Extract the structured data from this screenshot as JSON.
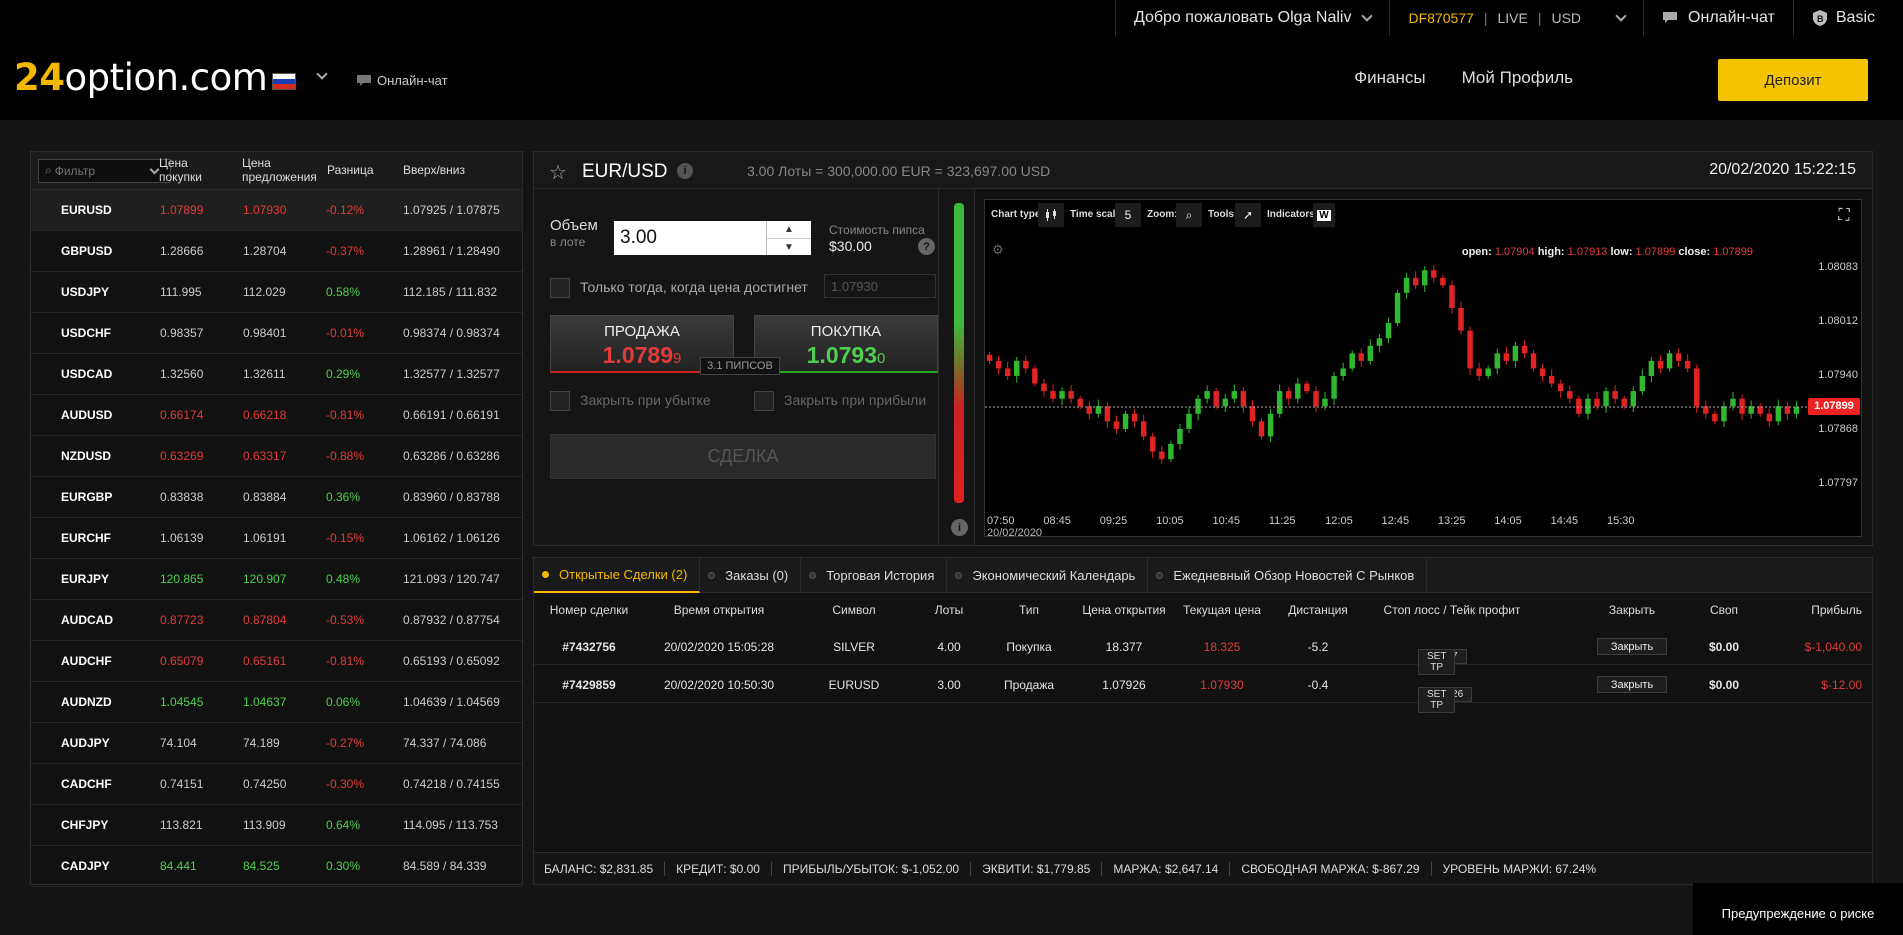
{
  "header": {
    "welcome": "Добро пожаловать Olga Naliv",
    "account_id": "DF870577",
    "separator": "|",
    "mode": "LIVE",
    "currency": "USD",
    "chat": "Онлайн-чат",
    "tier": "Basic",
    "logo_num": "24",
    "logo_rest": "option.com",
    "mini_chat": "Онлайн-чат",
    "nav": [
      "Финансы",
      "Мой Профиль"
    ],
    "deposit": "Депозит",
    "flag_colors": [
      "#ffffff",
      "#1c3fb5",
      "#d52b1e"
    ]
  },
  "watchlist": {
    "filter_placeholder": "Фильтр",
    "col_bid": "Цена покупки",
    "col_ask": "Цена предложения",
    "col_change": "Разница",
    "col_hl": "Вверх/вниз",
    "rows": [
      {
        "symbol": "EURUSD",
        "bid": "1.07899",
        "ask": "1.07930",
        "change": "-0.12%",
        "hl": "1.07925 / 1.07875",
        "color": "red"
      },
      {
        "symbol": "GBPUSD",
        "bid": "1.28666",
        "ask": "1.28704",
        "change": "-0.37%",
        "hl": "1.28961 / 1.28490",
        "color": "neut"
      },
      {
        "symbol": "USDJPY",
        "bid": "111.995",
        "ask": "112.029",
        "change": "0.58%",
        "hl": "112.185 / 111.832",
        "color": "neut"
      },
      {
        "symbol": "USDCHF",
        "bid": "0.98357",
        "ask": "0.98401",
        "change": "-0.01%",
        "hl": "0.98374 / 0.98374",
        "color": "neut"
      },
      {
        "symbol": "USDCAD",
        "bid": "1.32560",
        "ask": "1.32611",
        "change": "0.29%",
        "hl": "1.32577 / 1.32577",
        "color": "neut"
      },
      {
        "symbol": "AUDUSD",
        "bid": "0.66174",
        "ask": "0.66218",
        "change": "-0.81%",
        "hl": "0.66191 / 0.66191",
        "color": "red"
      },
      {
        "symbol": "NZDUSD",
        "bid": "0.63269",
        "ask": "0.63317",
        "change": "-0.88%",
        "hl": "0.63286 / 0.63286",
        "color": "red"
      },
      {
        "symbol": "EURGBP",
        "bid": "0.83838",
        "ask": "0.83884",
        "change": "0.36%",
        "hl": "0.83960 / 0.83788",
        "color": "neut"
      },
      {
        "symbol": "EURCHF",
        "bid": "1.06139",
        "ask": "1.06191",
        "change": "-0.15%",
        "hl": "1.06162 / 1.06126",
        "color": "neut"
      },
      {
        "symbol": "EURJPY",
        "bid": "120.865",
        "ask": "120.907",
        "change": "0.48%",
        "hl": "121.093 / 120.747",
        "color": "green"
      },
      {
        "symbol": "AUDCAD",
        "bid": "0.87723",
        "ask": "0.87804",
        "change": "-0.53%",
        "hl": "0.87932 / 0.87754",
        "color": "red"
      },
      {
        "symbol": "AUDCHF",
        "bid": "0.65079",
        "ask": "0.65161",
        "change": "-0.81%",
        "hl": "0.65193 / 0.65092",
        "color": "red"
      },
      {
        "symbol": "AUDNZD",
        "bid": "1.04545",
        "ask": "1.04637",
        "change": "0.06%",
        "hl": "1.04639 / 1.04569",
        "color": "green"
      },
      {
        "symbol": "AUDJPY",
        "bid": "74.104",
        "ask": "74.189",
        "change": "-0.27%",
        "hl": "74.337 / 74.086",
        "color": "neut"
      },
      {
        "symbol": "CADCHF",
        "bid": "0.74151",
        "ask": "0.74250",
        "change": "-0.30%",
        "hl": "0.74218 / 0.74155",
        "color": "neut"
      },
      {
        "symbol": "CHFJPY",
        "bid": "113.821",
        "ask": "113.909",
        "change": "0.64%",
        "hl": "114.095 / 113.753",
        "color": "neut"
      },
      {
        "symbol": "CADJPY",
        "bid": "84.441",
        "ask": "84.525",
        "change": "0.30%",
        "hl": "84.589 / 84.339",
        "color": "green"
      }
    ]
  },
  "trade": {
    "pair": "EUR/USD",
    "lot_info": "3.00 Лоты = 300,000.00 EUR = 323,697.00 USD",
    "datetime": "20/02/2020 15:22:15",
    "volume_label": "Объем",
    "volume_sub": "в лоте",
    "volume_value": "3.00",
    "pip_cost_label": "Стоимость пипса",
    "pip_cost_value": "$30.00",
    "limit_label": "Только тогда, когда цена достигнет",
    "limit_placeholder": "1.07930",
    "sell_label": "ПРОДАЖА",
    "sell_price_main": "1.0789",
    "sell_price_tail": "9",
    "buy_label": "ПОКУПКА",
    "buy_price_main": "1.0793",
    "buy_price_tail": "0",
    "spread": "3.1 ПИПСОВ",
    "stop_loss": "Закрыть при убытке",
    "take_profit": "Закрыть при прибыли",
    "deal": "СДЕЛКА"
  },
  "chart_toolbar": {
    "chart_type": "Chart type:",
    "time_scale": "Time scale",
    "time_scale_value": "5",
    "zoom": "Zoom:",
    "tools": "Tools:",
    "indicators": "Indicators:",
    "indicators_icon": "W"
  },
  "chart_data": {
    "type": "candlestick",
    "symbol": "EUR/USD",
    "interval_minutes": 5,
    "ohlc_labels": {
      "open": "open:",
      "high": "high:",
      "low": "low:",
      "close": "close:"
    },
    "last_ohlc": {
      "open": "1.07904",
      "high": "1.07913",
      "low": "1.07899",
      "close": "1.07899"
    },
    "last_price": "1.07899",
    "y_ticks": [
      "1.08083",
      "1.08012",
      "1.07940",
      "1.07868",
      "1.07797"
    ],
    "ylim": [
      1.0776,
      1.0812
    ],
    "x_ticks": [
      "07:50",
      "08:45",
      "09:25",
      "10:05",
      "10:45",
      "11:25",
      "12:05",
      "12:45",
      "13:25",
      "14:05",
      "14:45",
      "15:30"
    ],
    "date_label": "20/02/2020",
    "closes": [
      1.0796,
      1.0795,
      1.0794,
      1.0796,
      1.0795,
      1.0793,
      1.0792,
      1.0791,
      1.0792,
      1.0791,
      1.079,
      1.0789,
      1.079,
      1.0788,
      1.0787,
      1.0789,
      1.0788,
      1.0786,
      1.0784,
      1.0783,
      1.0785,
      1.0787,
      1.0789,
      1.0791,
      1.0792,
      1.079,
      1.0791,
      1.0792,
      1.079,
      1.0788,
      1.0786,
      1.0789,
      1.0792,
      1.0791,
      1.0793,
      1.0792,
      1.079,
      1.0791,
      1.0794,
      1.0795,
      1.0797,
      1.0796,
      1.0798,
      1.0799,
      1.0801,
      1.0805,
      1.0807,
      1.0806,
      1.0808,
      1.0807,
      1.0806,
      1.0803,
      1.08,
      1.0795,
      1.0794,
      1.0795,
      1.0797,
      1.0796,
      1.0798,
      1.0797,
      1.0795,
      1.0794,
      1.0793,
      1.0792,
      1.0791,
      1.0789,
      1.0791,
      1.079,
      1.0792,
      1.0791,
      1.079,
      1.0792,
      1.0794,
      1.0796,
      1.0795,
      1.0797,
      1.0796,
      1.0795,
      1.079,
      1.0789,
      1.0788,
      1.079,
      1.0791,
      1.0789,
      1.079,
      1.0789,
      1.0788,
      1.079,
      1.0789,
      1.07899
    ]
  },
  "positions": {
    "tabs": [
      "Открытые Сделки (2)",
      "Заказы (0)",
      "Торговая История",
      "Экономический Календарь",
      "Ежедневный Обзор Новостей С Рынков"
    ],
    "headers": [
      "Номер сделки",
      "Время открытия",
      "Символ",
      "Лоты",
      "Тип",
      "Цена открытия",
      "Текущая цена",
      "Дистанция",
      "Стоп лосс / Тейк профит",
      "Закрыть",
      "Своп",
      "Прибыль"
    ],
    "rows": [
      {
        "id": "#7432756",
        "time": "20/02/2020 15:05:28",
        "symbol": "SILVER",
        "lots": "4.00",
        "type": "Покупка",
        "open": "18.377",
        "current": "18.325",
        "distance": "-5.2",
        "sl": "18.267",
        "tp": "SET TP",
        "close": "Закрыть",
        "swap": "$0.00",
        "profit": "$-1,040.00"
      },
      {
        "id": "#7429859",
        "time": "20/02/2020 10:50:30",
        "symbol": "EURUSD",
        "lots": "3.00",
        "type": "Продажа",
        "open": "1.07926",
        "current": "1.07930",
        "distance": "-0.4",
        "sl": "1.08126",
        "tp": "SET TP",
        "close": "Закрыть",
        "swap": "$0.00",
        "profit": "$-12.00"
      }
    ],
    "slash": "/",
    "footer": [
      "БАЛАНС: $2,831.85",
      "КРЕДИТ: $0.00",
      "ПРИБЫЛЬ/УБЫТОК: $-1,052.00",
      "ЭКВИТИ: $1,779.85",
      "МАРЖА: $2,647.14",
      "СВОБОДНАЯ МАРЖА: $-867.29",
      "УРОВЕНЬ МАРЖИ: 67.24%"
    ]
  },
  "risk_warning": "Предупреждение о риске"
}
